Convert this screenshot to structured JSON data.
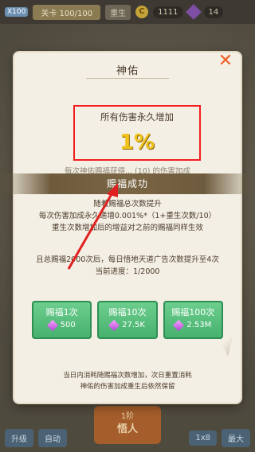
{
  "background": {
    "level_badge": "X100",
    "stage": "关卡 100/100",
    "rebirth_label": "重生",
    "coin_icon": "C",
    "coins": "1111",
    "gems": "14",
    "bottom": {
      "upgrade_label": "升级",
      "auto_label": "自动",
      "center_level": "1阶",
      "center_title": "悟人",
      "speed": "1x8",
      "max_label": "最大"
    }
  },
  "modal": {
    "title": "神佑",
    "close_icon": "close-icon",
    "bonus_label": "所有伤害永久增加",
    "bonus_value": "1%",
    "faded_line": "每次神佑赐福获得... (10) 的伤害加成",
    "banner_text": "赐福成功",
    "desc_lines": [
      "随着赐福总次数提升",
      "每次伤害加成永久递增0.001%*（1+重生次数/10）",
      "重生次数增加后的增益对之前的赐福同样生效"
    ],
    "info_line": "且总赐福2000次后，每日悟地天道广告次数提升至4次",
    "progress": "当前进度：1/2000",
    "cards": [
      {
        "label": "赐福1次",
        "cost": "500"
      },
      {
        "label": "赐福10次",
        "cost": "27.5K"
      },
      {
        "label": "赐福100次",
        "cost": "2.53M"
      }
    ],
    "footnotes": [
      "当日内消耗随赐福次数增加，次日重置消耗",
      "神佑的伤害加成重生后依然保留"
    ]
  },
  "colors": {
    "accent_red": "#f31d1d",
    "gold": "#f2c21b",
    "green_button": "#45b06d",
    "close_orange": "#f06025"
  }
}
